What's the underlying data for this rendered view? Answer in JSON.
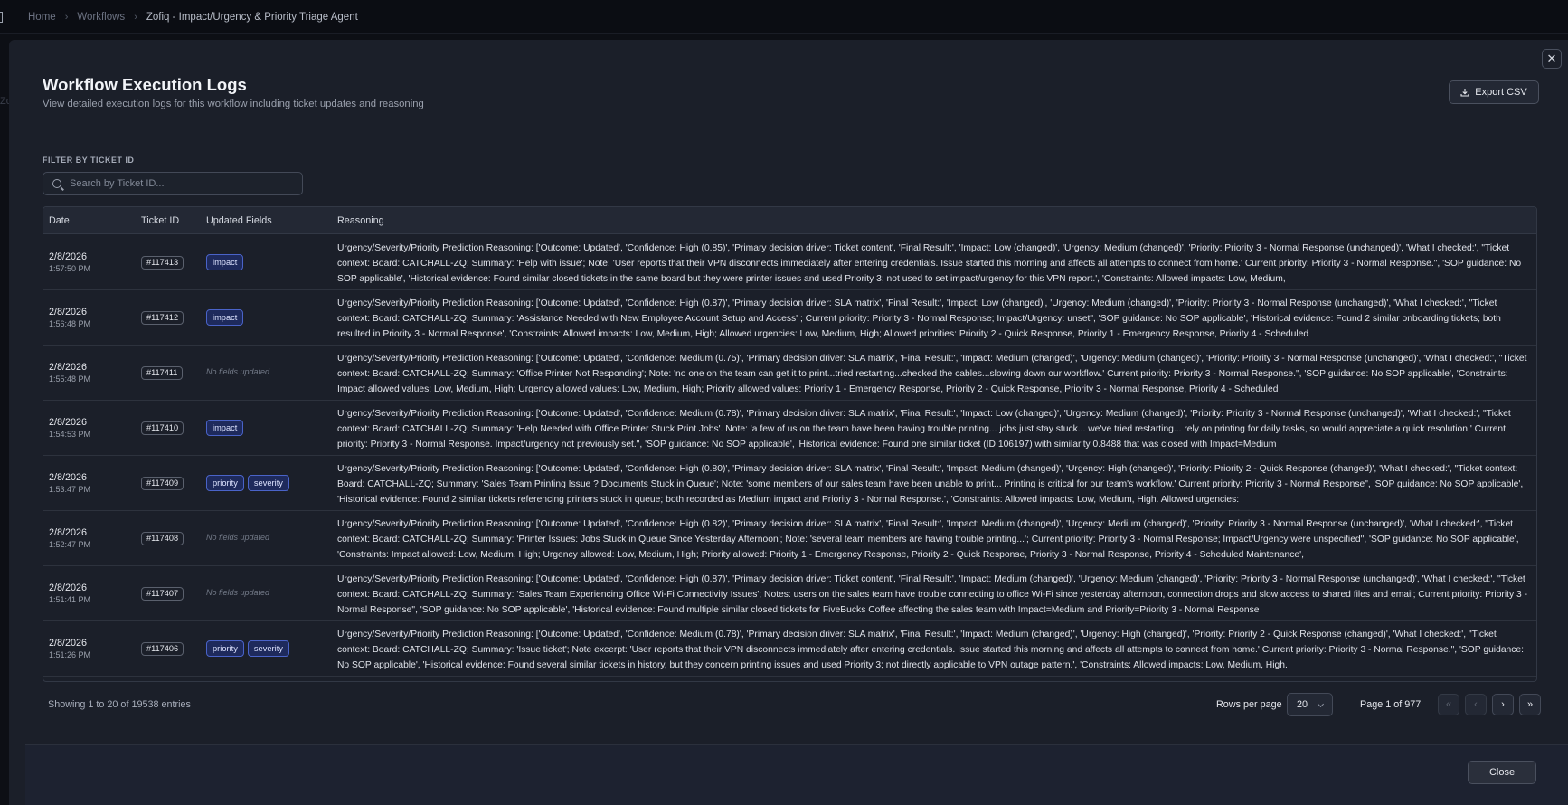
{
  "breadcrumb": {
    "items": [
      "Home",
      "Workflows"
    ],
    "current": "Zofiq - Impact/Urgency & Priority Triage Agent"
  },
  "background": {
    "fragment": "Zo"
  },
  "modal": {
    "title": "Workflow Execution Logs",
    "subtitle": "View detailed execution logs for this workflow including ticket updates and reasoning",
    "export_label": "Export CSV",
    "close_label": "Close",
    "close_icon": "✕"
  },
  "filter": {
    "label": "FILTER BY TICKET ID",
    "placeholder": "Search by Ticket ID..."
  },
  "table": {
    "headers": [
      "Date",
      "Ticket ID",
      "Updated Fields",
      "Reasoning"
    ],
    "no_fields_text": "No fields updated",
    "rows": [
      {
        "date": "2/8/2026",
        "time": "1:57:50 PM",
        "ticket": "#117413",
        "fields": [
          "impact"
        ],
        "reasoning": "Urgency/Severity/Priority Prediction Reasoning: ['Outcome: Updated', 'Confidence: High (0.85)', 'Primary decision driver: Ticket content', 'Final Result:', 'Impact: Low (changed)', 'Urgency: Medium (changed)', 'Priority: Priority 3 - Normal Response (unchanged)', 'What I checked:', \"Ticket context: Board: CATCHALL-ZQ; Summary: 'Help with issue'; Note: 'User reports that their VPN disconnects immediately after entering credentials. Issue started this morning and affects all attempts to connect from home.' Current priority: Priority 3 - Normal Response.\", 'SOP guidance: No SOP applicable', 'Historical evidence: Found similar closed tickets in the same board but they were printer issues and used Priority 3; not used to set impact/urgency for this VPN report.', 'Constraints: Allowed impacts: Low, Medium,"
      },
      {
        "date": "2/8/2026",
        "time": "1:56:48 PM",
        "ticket": "#117412",
        "fields": [
          "impact"
        ],
        "reasoning": "Urgency/Severity/Priority Prediction Reasoning: ['Outcome: Updated', 'Confidence: High (0.87)', 'Primary decision driver: SLA matrix', 'Final Result:', 'Impact: Low (changed)', 'Urgency: Medium (changed)', 'Priority: Priority 3 - Normal Response (unchanged)', 'What I checked:', \"Ticket context: Board: CATCHALL-ZQ; Summary: 'Assistance Needed with New Employee Account Setup and Access' ; Current priority: Priority 3 - Normal Response; Impact/Urgency: unset\", 'SOP guidance: No SOP applicable', 'Historical evidence: Found 2 similar onboarding tickets; both resulted in Priority 3 - Normal Response', 'Constraints: Allowed impacts: Low, Medium, High; Allowed urgencies: Low, Medium, High; Allowed priorities: Priority 2 - Quick Response, Priority 1 - Emergency Response, Priority 4 - Scheduled"
      },
      {
        "date": "2/8/2026",
        "time": "1:55:48 PM",
        "ticket": "#117411",
        "fields": [],
        "reasoning": "Urgency/Severity/Priority Prediction Reasoning: ['Outcome: Updated', 'Confidence: Medium (0.75)', 'Primary decision driver: SLA matrix', 'Final Result:', 'Impact: Medium (changed)', 'Urgency: Medium (changed)', 'Priority: Priority 3 - Normal Response (unchanged)', 'What I checked:', \"Ticket context: Board: CATCHALL-ZQ; Summary: 'Office Printer Not Responding'; Note: 'no one on the team can get it to print...tried restarting...checked the cables...slowing down our workflow.' Current priority: Priority 3 - Normal Response.\", 'SOP guidance: No SOP applicable', 'Constraints: Impact allowed values: Low, Medium, High; Urgency allowed values: Low, Medium, High; Priority allowed values: Priority 1 - Emergency Response, Priority 2 - Quick Response, Priority 3 - Normal Response, Priority 4 - Scheduled"
      },
      {
        "date": "2/8/2026",
        "time": "1:54:53 PM",
        "ticket": "#117410",
        "fields": [
          "impact"
        ],
        "reasoning": "Urgency/Severity/Priority Prediction Reasoning: ['Outcome: Updated', 'Confidence: Medium (0.78)', 'Primary decision driver: SLA matrix', 'Final Result:', 'Impact: Low (changed)', 'Urgency: Medium (changed)', 'Priority: Priority 3 - Normal Response (unchanged)', 'What I checked:', \"Ticket context: Board: CATCHALL-ZQ; Summary: 'Help Needed with Office Printer Stuck Print Jobs'. Note: 'a few of us on the team have been having trouble printing... jobs just stay stuck... we've tried restarting... rely on printing for daily tasks, so would appreciate a quick resolution.' Current priority: Priority 3 - Normal Response. Impact/urgency not previously set.\", 'SOP guidance: No SOP applicable', 'Historical evidence: Found one similar ticket (ID 106197) with similarity 0.8488 that was closed with Impact=Medium"
      },
      {
        "date": "2/8/2026",
        "time": "1:53:47 PM",
        "ticket": "#117409",
        "fields": [
          "priority",
          "severity"
        ],
        "reasoning": "Urgency/Severity/Priority Prediction Reasoning: ['Outcome: Updated', 'Confidence: High (0.80)', 'Primary decision driver: SLA matrix', 'Final Result:', 'Impact: Medium (changed)', 'Urgency: High (changed)', 'Priority: Priority 2 - Quick Response (changed)', 'What I checked:', \"Ticket context: Board: CATCHALL-ZQ; Summary: 'Sales Team Printing Issue ? Documents Stuck in Queue'; Note: 'some members of our sales team have been unable to print... Printing is critical for our team's workflow.' Current priority: Priority 3 - Normal Response\", 'SOP guidance: No SOP applicable', 'Historical evidence: Found 2 similar tickets referencing printers stuck in queue; both recorded as Medium impact and Priority 3 - Normal Response.', 'Constraints: Allowed impacts: Low, Medium, High. Allowed urgencies:"
      },
      {
        "date": "2/8/2026",
        "time": "1:52:47 PM",
        "ticket": "#117408",
        "fields": [],
        "reasoning": "Urgency/Severity/Priority Prediction Reasoning: ['Outcome: Updated', 'Confidence: High (0.82)', 'Primary decision driver: SLA matrix', 'Final Result:', 'Impact: Medium (changed)', 'Urgency: Medium (changed)', 'Priority: Priority 3 - Normal Response (unchanged)', 'What I checked:', \"Ticket context: Board: CATCHALL-ZQ; Summary: 'Printer Issues: Jobs Stuck in Queue Since Yesterday Afternoon'; Note: 'several team members are having trouble printing...'; Current priority: Priority 3 - Normal Response; Impact/Urgency were unspecified\", 'SOP guidance: No SOP applicable', 'Constraints: Impact allowed: Low, Medium, High; Urgency allowed: Low, Medium, High; Priority allowed: Priority 1 - Emergency Response, Priority 2 - Quick Response, Priority 3 - Normal Response, Priority 4 - Scheduled Maintenance',"
      },
      {
        "date": "2/8/2026",
        "time": "1:51:41 PM",
        "ticket": "#117407",
        "fields": [],
        "reasoning": "Urgency/Severity/Priority Prediction Reasoning: ['Outcome: Updated', 'Confidence: High (0.87)', 'Primary decision driver: Ticket content', 'Final Result:', 'Impact: Medium (changed)', 'Urgency: Medium (changed)', 'Priority: Priority 3 - Normal Response (unchanged)', 'What I checked:', \"Ticket context: Board: CATCHALL-ZQ; Summary: 'Sales Team Experiencing Office Wi-Fi Connectivity Issues'; Notes: users on the sales team have trouble connecting to office Wi-Fi since yesterday afternoon, connection drops and slow access to shared files and email; Current priority: Priority 3 - Normal Response\", 'SOP guidance: No SOP applicable', 'Historical evidence: Found multiple similar closed tickets for FiveBucks Coffee affecting the sales team with Impact=Medium and Priority=Priority 3 - Normal Response"
      },
      {
        "date": "2/8/2026",
        "time": "1:51:26 PM",
        "ticket": "#117406",
        "fields": [
          "priority",
          "severity"
        ],
        "reasoning": "Urgency/Severity/Priority Prediction Reasoning: ['Outcome: Updated', 'Confidence: Medium (0.78)', 'Primary decision driver: SLA matrix', 'Final Result:', 'Impact: Medium (changed)', 'Urgency: High (changed)', 'Priority: Priority 2 - Quick Response (changed)', 'What I checked:', \"Ticket context: Board: CATCHALL-ZQ; Summary: 'Issue ticket'; Note excerpt: 'User reports that their VPN disconnects immediately after entering credentials. Issue started this morning and affects all attempts to connect from home.' Current priority: Priority 3 - Normal Response.\", 'SOP guidance: No SOP applicable', 'Historical evidence: Found several similar tickets in history, but they concern printing issues and used Priority 3; not directly applicable to VPN outage pattern.', 'Constraints: Allowed impacts: Low, Medium, High."
      }
    ]
  },
  "pagination": {
    "showing": "Showing 1 to 20 of 19538 entries",
    "rows_per_page_label": "Rows per page",
    "rows_per_page_value": "20",
    "page_info": "Page 1 of 977",
    "first": "«",
    "prev": "‹",
    "next": "›",
    "last": "»"
  }
}
